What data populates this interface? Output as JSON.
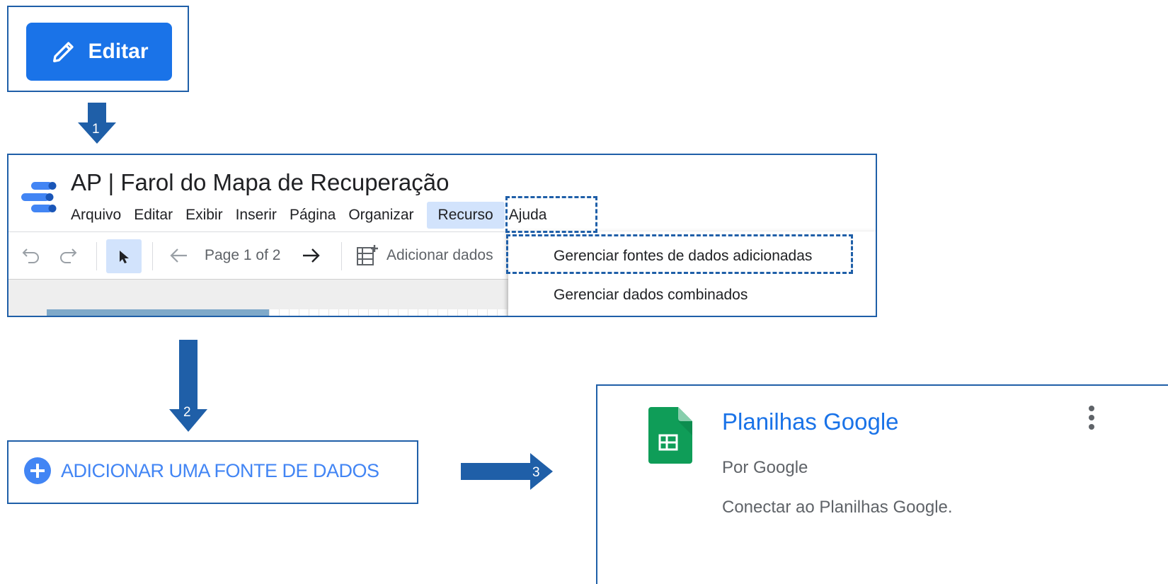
{
  "step1": {
    "edit_button_label": "Editar"
  },
  "steps": {
    "one": "1",
    "two": "2",
    "three": "3"
  },
  "editor": {
    "doc_title": "AP | Farol do Mapa de Recuperação",
    "menu": [
      "Arquivo",
      "Editar",
      "Exibir",
      "Inserir",
      "Página",
      "Organizar",
      "Recurso",
      "Ajuda"
    ],
    "active_menu": "Recurso",
    "toolbar": {
      "page_label": "Page 1 of 2",
      "add_data_label": "Adicionar dados"
    },
    "resource_menu": {
      "items": [
        "Gerenciar fontes de dados adicionadas",
        "Gerenciar dados combinados"
      ],
      "highlighted": "Gerenciar fontes de dados adicionadas"
    }
  },
  "add_source": {
    "label": "ADICIONAR UMA FONTE DE DADOS"
  },
  "connector_card": {
    "title": "Planilhas Google",
    "by": "Por Google",
    "description": "Conectar ao Planilhas Google."
  },
  "colors": {
    "accent": "#1a73e8",
    "arrow": "#1f5fa8",
    "highlight": "#d2e3fc",
    "sheets_green": "#0f9d58"
  },
  "icons": [
    "pencil-icon",
    "looker-studio-logo-icon",
    "undo-icon",
    "redo-icon",
    "select-cursor-icon",
    "arrow-left-icon",
    "arrow-right-icon",
    "add-data-icon",
    "plus-circle-icon",
    "google-sheets-icon",
    "more-vert-icon"
  ]
}
